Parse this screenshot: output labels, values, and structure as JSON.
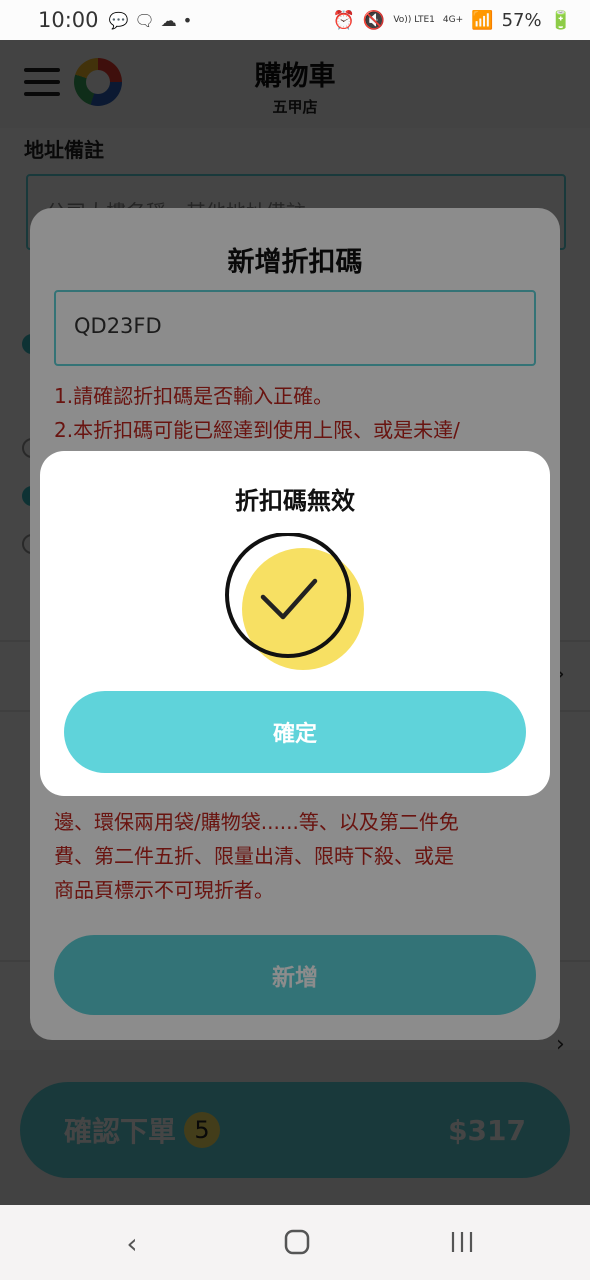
{
  "status_bar": {
    "time": "10:00",
    "battery": "57%",
    "volte": "Vo)) LTE1",
    "network": "4G+"
  },
  "header": {
    "title": "購物車",
    "subtitle": "五甲店"
  },
  "background": {
    "address_label": "地址備註",
    "address_placeholder": "公司大樓名稱、其他地址備註"
  },
  "coupon_dialog": {
    "title": "新增折扣碼",
    "code_value": "QD23FD",
    "rules": [
      "1.請確認折扣碼是否輸入正確。",
      "2.本折扣碼可能已經達到使用上限、或是未達/",
      "邊、環保兩用袋/購物袋......等、以及第二件免",
      "費、第二件五折、限量出清、限時下殺、或是",
      "商品頁標示不可現折者。"
    ],
    "add_button": "新增"
  },
  "alert_dialog": {
    "title": "折扣碼無效",
    "confirm_button": "確定"
  },
  "order_bar": {
    "label": "確認下單",
    "count": "5",
    "total": "$317"
  },
  "colors": {
    "accent": "#5dd2d9",
    "error_text": "#c0251e",
    "check_fill": "#f7e063"
  },
  "icons": {
    "nav_back": "chevron-left-icon",
    "nav_home": "home-icon",
    "nav_recents": "recents-icon",
    "success": "check-circle-icon"
  }
}
